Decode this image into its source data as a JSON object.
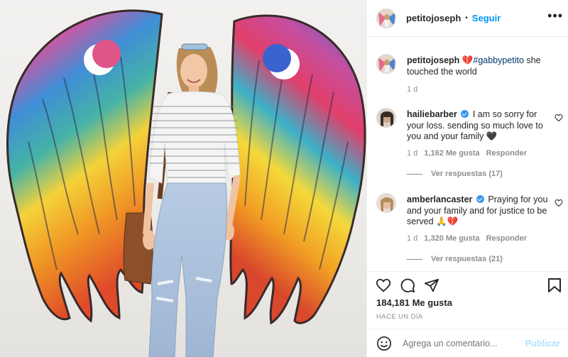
{
  "post": {
    "username": "petitojoseph",
    "follow_label": "Seguir",
    "more_label": "•••"
  },
  "comments": [
    {
      "username": "petitojoseph",
      "verified": false,
      "emoji": "💔",
      "hashtag": "#gabbypetito",
      "text": " she touched the world",
      "time": "1 d"
    },
    {
      "username": "hailiebarber",
      "verified": true,
      "text": " I am so sorry for your loss. sending so much love to you and your family 🖤",
      "time": "1 d",
      "likes": "1,162 Me gusta",
      "reply": "Responder",
      "view_replies": "Ver respuestas (17)"
    },
    {
      "username": "amberlancaster",
      "verified": true,
      "text": " Praying for you and your family and for justice to be served 🙏💔",
      "time": "1 d",
      "likes": "1,320 Me gusta",
      "reply": "Responder",
      "view_replies": "Ver respuestas (21)"
    }
  ],
  "actions": {
    "likes_count": "184,181 Me gusta",
    "posted": "HACE UN DÍA",
    "comment_placeholder": "Agrega un comentario...",
    "publish_label": "Publicar"
  },
  "icons": {
    "like": "heart-icon",
    "comment": "comment-icon",
    "share": "send-icon",
    "save": "bookmark-icon",
    "emoji": "emoji-icon",
    "more": "more-icon"
  },
  "colors": {
    "link": "#0095f6",
    "hashtag": "#00376b",
    "muted": "#8e8e8e",
    "verified": "#3897f0",
    "publish_disabled": "#b2dffc"
  }
}
